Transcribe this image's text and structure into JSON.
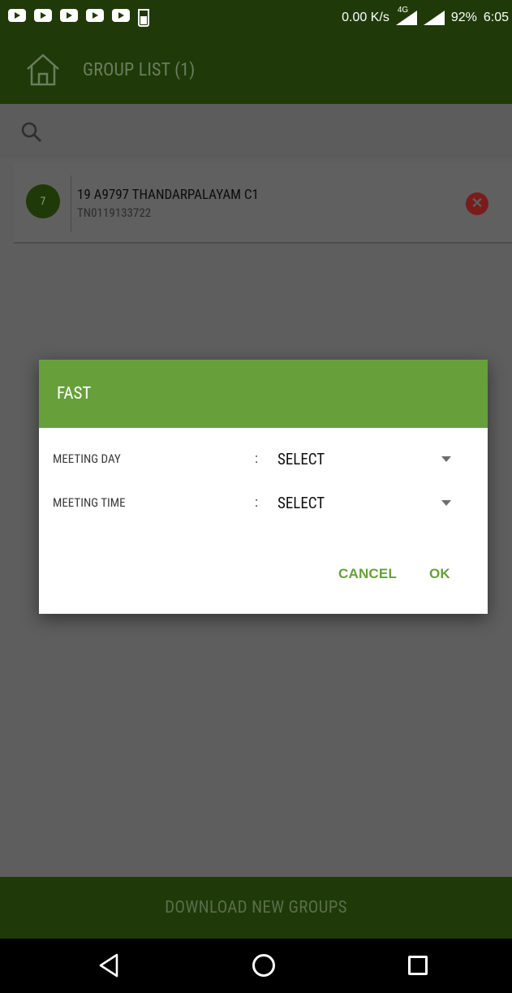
{
  "status_bar": {
    "speed": "0.00 K/s",
    "network": "4G",
    "battery": "92%",
    "time": "6:05"
  },
  "app_bar": {
    "title": "GROUP LIST (1)",
    "home_icon": "home-icon"
  },
  "search": {
    "icon": "search-icon"
  },
  "groups": [
    {
      "avatar_text": "7",
      "name": "19 A9797 THANDARPALAYAM C1",
      "code": "TN0119133722"
    }
  ],
  "dialog": {
    "title": "FAST",
    "fields": [
      {
        "label": "MEETING DAY",
        "colon": ":",
        "value": "SELECT"
      },
      {
        "label": "MEETING TIME",
        "colon": ":",
        "value": "SELECT"
      }
    ],
    "cancel_label": "CANCEL",
    "ok_label": "OK"
  },
  "bottom_button": {
    "label": "DOWNLOAD NEW GROUPS"
  },
  "colors": {
    "primary_dark": "#1f3a08",
    "accent": "#67a03a",
    "overlay": "#5e5e5e",
    "delete": "#c62828"
  }
}
